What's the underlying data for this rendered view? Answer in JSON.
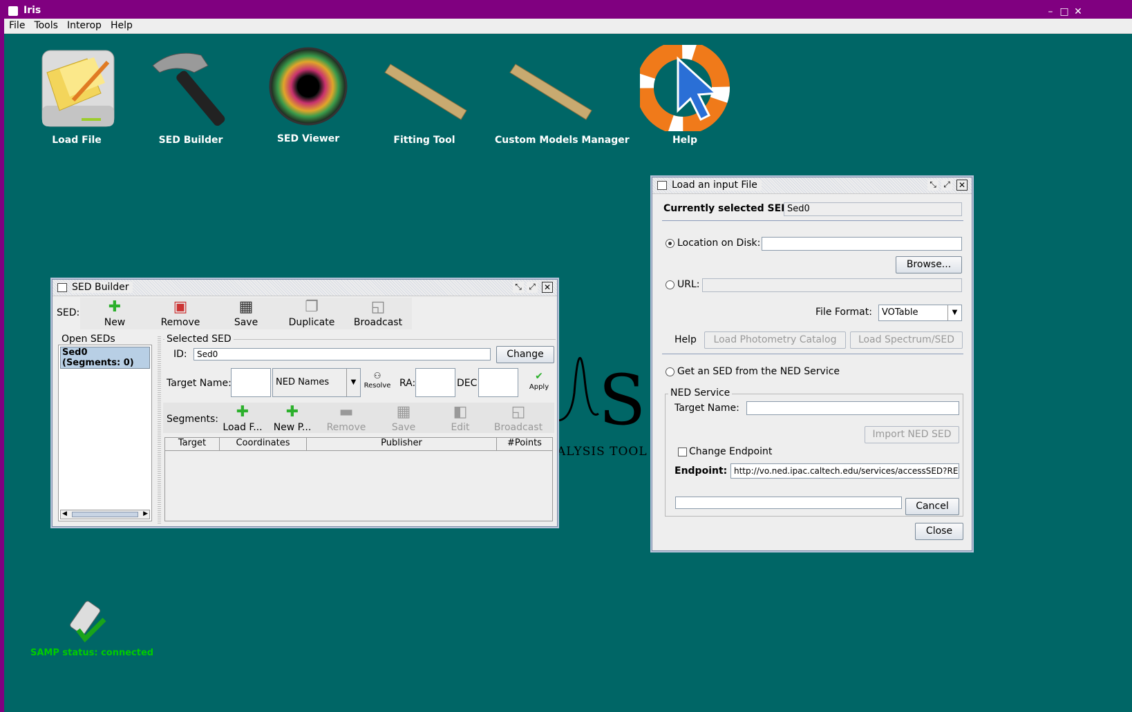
{
  "app": {
    "title": "Iris"
  },
  "menu": [
    "File",
    "Tools",
    "Interop",
    "Help"
  ],
  "desktop_icons": [
    {
      "label": "Load File",
      "icon": "load-file-icon"
    },
    {
      "label": "SED Builder",
      "icon": "hammer-icon"
    },
    {
      "label": "SED Viewer",
      "icon": "eye-icon"
    },
    {
      "label": "Fitting Tool",
      "icon": "ruler-icon"
    },
    {
      "label": "Custom Models Manager",
      "icon": "ruler-icon"
    },
    {
      "label": "Help",
      "icon": "lifebuoy-icon"
    }
  ],
  "logo": {
    "text": "ALYSIS TOOL"
  },
  "samp": {
    "status": "SAMP status: connected",
    "color": "#00cc00"
  },
  "sed_builder": {
    "title": "SED Builder",
    "sed_label": "SED:",
    "toolbar": [
      {
        "label": "New",
        "icon": "plus-icon",
        "enabled": true
      },
      {
        "label": "Remove",
        "icon": "remove-icon",
        "enabled": true
      },
      {
        "label": "Save",
        "icon": "floppy-icon",
        "enabled": true
      },
      {
        "label": "Duplicate",
        "icon": "duplicate-icon",
        "enabled": true
      },
      {
        "label": "Broadcast",
        "icon": "broadcast-icon",
        "enabled": true
      }
    ],
    "open_seds_label": "Open SEDs",
    "open_seds": [
      "Sed0 (Segments: 0)"
    ],
    "selected_sed_label": "Selected SED",
    "id_label": "ID:",
    "id_value": "Sed0",
    "change_button": "Change",
    "target_name_label": "Target Name:",
    "resolver": "NED Names",
    "resolve_button": "Resolve",
    "ra_label": "RA:",
    "dec_label": "DEC:",
    "apply_button": "Apply",
    "segments_label": "Segments:",
    "segment_toolbar": [
      {
        "label": "Load F...",
        "enabled": true
      },
      {
        "label": "New P...",
        "enabled": true
      },
      {
        "label": "Remove",
        "enabled": false
      },
      {
        "label": "Save",
        "enabled": false
      },
      {
        "label": "Edit",
        "enabled": false
      },
      {
        "label": "Broadcast",
        "enabled": false
      }
    ],
    "table_columns": [
      "Target",
      "Coordinates",
      "Publisher",
      "#Points"
    ]
  },
  "load_file": {
    "title": "Load an input File",
    "current_sed_label": "Currently selected SED:",
    "current_sed_value": "Sed0",
    "location_label": "Location on Disk:",
    "location_value": "",
    "browse_button": "Browse...",
    "url_label": "URL:",
    "url_value": "",
    "file_format_label": "File Format:",
    "file_format_value": "VOTable",
    "help_label": "Help",
    "load_photometry_button": "Load Photometry Catalog",
    "load_spectrum_button": "Load Spectrum/SED",
    "ned_radio_label": "Get an SED from the NED Service",
    "ned_group_label": "NED Service",
    "ned_target_label": "Target Name:",
    "ned_target_value": "",
    "import_ned_button": "Import NED SED",
    "change_endpoint_label": "Change Endpoint",
    "endpoint_label": "Endpoint:",
    "endpoint_value": "http://vo.ned.ipac.caltech.edu/services/accessSED?REQ",
    "cancel_button": "Cancel",
    "close_button": "Close"
  }
}
